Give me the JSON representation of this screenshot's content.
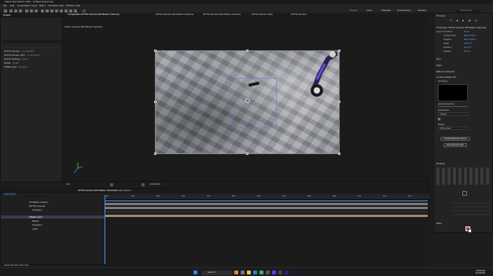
{
  "window": {
    "title": "Adobe After Effects 2024 - Untitled Project.aep"
  },
  "menu": [
    "File",
    "Edit",
    "Composition",
    "Layer",
    "Effect",
    "Animation",
    "View",
    "Window",
    "Help"
  ],
  "workspaces": {
    "items": [
      "Default",
      "Learn",
      "Standard",
      "Small Screen",
      "Libraries"
    ],
    "active": "Default",
    "search_placeholder": "Search Help"
  },
  "project": {
    "tab": "Project",
    "search_placeholder": "",
    "items": [
      {
        "name": "AVTW Camera",
        "type": "Composition"
      },
      {
        "name": "AVTW Camera (3D)",
        "type": "Composition"
      },
      {
        "name": "AVTW Tracking",
        "type": "Folder"
      },
      {
        "name": "Solids",
        "type": "Folder"
      },
      {
        "name": "VIDEO.mp4",
        "type": "Footage"
      }
    ]
  },
  "viewer": {
    "tabs": [
      "Composition AVTW Camera (3D Master Camera)",
      "AVTW Camera (3D Master Camera)",
      "AVTW Camera (3D Master Camera)",
      "AVTW Camera (3D)",
      "AVTW Camera"
    ],
    "label": "Active Camera (3D Master Camera)",
    "zoom": "Full",
    "time": "0;00;00;00"
  },
  "right": {
    "preview": "Preview",
    "properties": "Properties: AVTW Camera (3D Master Camera)",
    "layer_transform": "Layer Transform",
    "reset": "Reset",
    "props": [
      {
        "label": "Anchor Point",
        "value": "960.0 540.0"
      },
      {
        "label": "Position",
        "value": "960.0 540.0"
      },
      {
        "label": "Scale",
        "value": "100.0 %"
      },
      {
        "label": "Rotation",
        "value": "0x+0.0°"
      },
      {
        "label": "Opacity",
        "value": "100 %"
      }
    ],
    "sections": [
      "Text",
      "Align",
      "Effects & Presets"
    ],
    "content_aware": "Content-Aware Fill",
    "fill_target": "Fill Target",
    "alpha_expansion": "Alpha Expansion",
    "fill_method": "Fill Method",
    "fill_method_value": "Object",
    "range": "Range",
    "range_value": "Work Area",
    "create_reference": "Create Reference Frame",
    "generate": "Generate Fill Layer",
    "brushes": "Brushes",
    "paint": "Paint"
  },
  "timeline": {
    "tabs": [
      "AVTW Camera (3D Master Camera)",
      "Render Queue"
    ],
    "time": "0;00;00;00",
    "ruler": [
      "0s",
      "01s",
      "02s",
      "03s",
      "04s",
      "05s",
      "06s",
      "07s",
      "08s",
      "09s",
      "10s",
      "11s",
      "12s"
    ],
    "layers": [
      {
        "name": "3D Master Camera"
      },
      {
        "name": "[AVTW Camera]"
      },
      {
        "name": "Transform"
      },
      {
        "name": "[VIDEO.mp4]"
      },
      {
        "name": "Effects"
      },
      {
        "name": "Transform"
      },
      {
        "name": "Audio"
      }
    ],
    "footer": "Frame Render Time: 0ms"
  },
  "taskbar": {
    "search": "Search",
    "time": "10:56 AM",
    "date": "3/13/2024"
  },
  "colors": {
    "accent": "#5aa0ff",
    "track_gray": "#7a7a7a",
    "track_tan": "#9a8a6a",
    "playhead": "#4a90ff",
    "swatch": "#e02020"
  }
}
